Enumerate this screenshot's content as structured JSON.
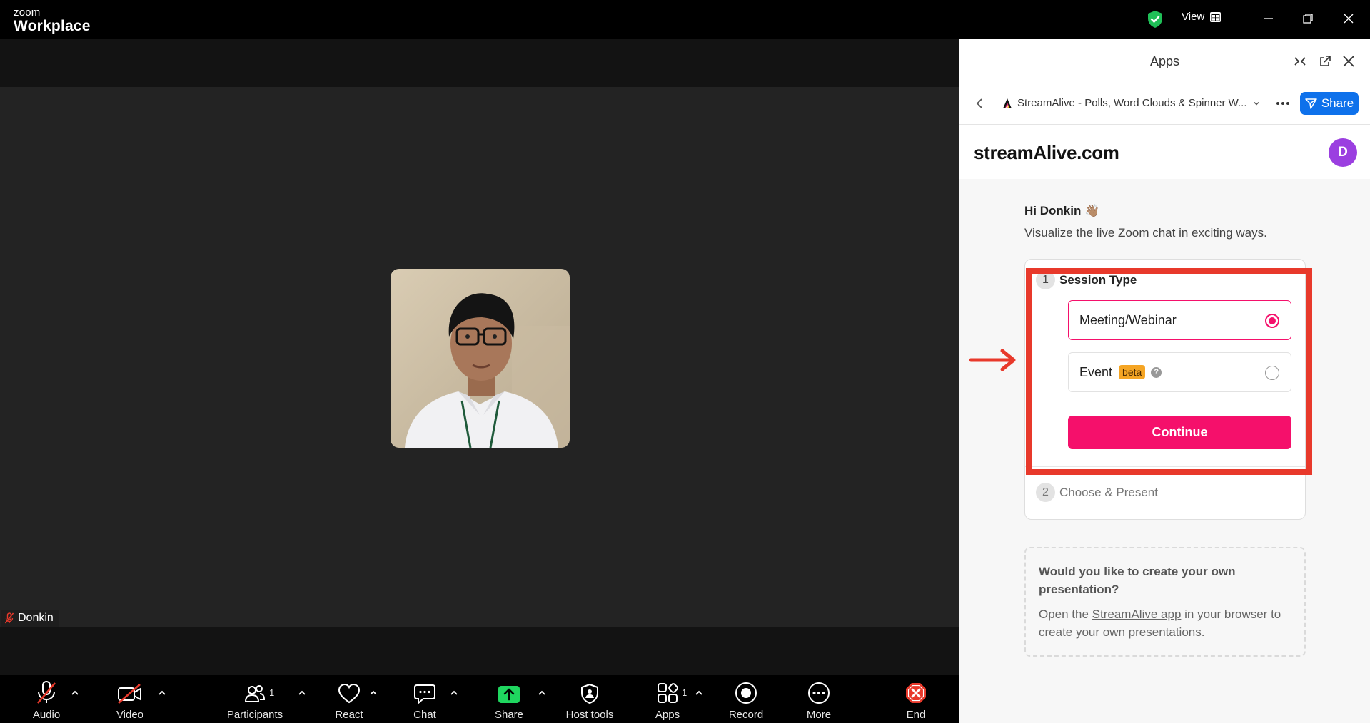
{
  "window": {
    "brand_small": "zoom",
    "brand_large": "Workplace",
    "view_label": "View"
  },
  "meeting": {
    "participant_name": "Donkin"
  },
  "toolbar": {
    "audio": "Audio",
    "video": "Video",
    "participants": "Participants",
    "participants_count": "1",
    "react": "React",
    "chat": "Chat",
    "share": "Share",
    "host_tools": "Host tools",
    "apps": "Apps",
    "apps_count": "1",
    "record": "Record",
    "more": "More",
    "end": "End"
  },
  "panel": {
    "title": "Apps",
    "app_name": "StreamAlive - Polls, Word Clouds & Spinner W...",
    "share_label": "Share",
    "logo_text": "streamAlive.com",
    "avatar_letter": "D"
  },
  "streamalive": {
    "greeting": "Hi Donkin 👋🏽",
    "subtitle": "Visualize the live Zoom chat in exciting ways.",
    "step1_number": "1",
    "step1_title": "Session Type",
    "option_meeting": "Meeting/Webinar",
    "option_event": "Event",
    "beta_badge": "beta",
    "help_mark": "?",
    "continue_label": "Continue",
    "step2_number": "2",
    "step2_title": "Choose & Present",
    "promo_title": "Would you like to create your own presentation?",
    "promo_text_before": "Open the ",
    "promo_link": "StreamAlive app",
    "promo_text_after": " in your browser to create your own presentations."
  },
  "colors": {
    "accent_pink": "#f5106b",
    "zoom_blue": "#0e71eb",
    "annotation_red": "#e8392b",
    "share_green": "#1fd65f",
    "avatar_purple": "#9b3fe0"
  }
}
